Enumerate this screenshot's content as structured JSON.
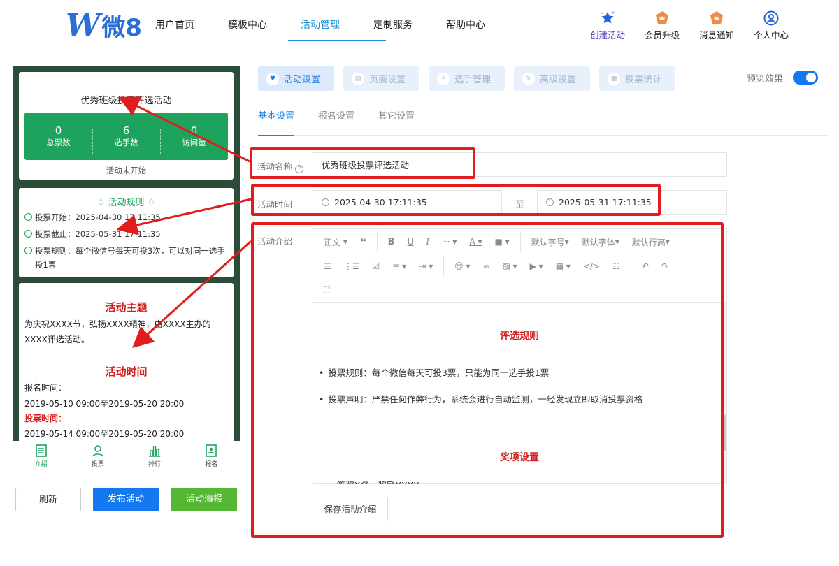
{
  "brand": {
    "logo_text": "微8"
  },
  "nav": {
    "items": [
      "用户首页",
      "模板中心",
      "活动管理",
      "定制服务",
      "帮助中心"
    ],
    "active": 2
  },
  "header_icons": [
    "创建活动",
    "会员升级",
    "消息通知",
    "个人中心"
  ],
  "preview": {
    "activity_title": "优秀班级投票评选活动",
    "stats": [
      {
        "value": "0",
        "label": "总票数"
      },
      {
        "value": "6",
        "label": "选手数"
      },
      {
        "value": "0",
        "label": "访问量"
      }
    ],
    "status": "活动未开始",
    "rules_title": "活动规则",
    "rules": [
      "投票开始：2025-04-30 17:11:35",
      "投票截止：2025-05-31 17:11:35",
      "投票规则：每个微信号每天可投3次，可以对同一选手投1票"
    ],
    "theme_title": "活动主题",
    "theme_text": "为庆祝XXXX节，弘扬XXXX精神，由XXXX主办的XXXX评选活动。",
    "time_title": "活动时间",
    "signup_label": "报名时间：",
    "signup_time": "2019-05-10 09:00至2019-05-20 20:00",
    "vote_label": "投票时间：",
    "vote_time": "2019-05-14 09:00至2019-05-20 20:00",
    "bottom_nav": [
      "介绍",
      "投票",
      "排行",
      "报名"
    ]
  },
  "buttons": {
    "refresh": "刷新",
    "publish": "发布活动",
    "poster": "活动海报"
  },
  "tabs": [
    "活动设置",
    "页面设置",
    "选手管理",
    "高级设置",
    "投票统计"
  ],
  "preview_toggle_label": "预览效果",
  "subtabs": [
    "基本设置",
    "报名设置",
    "其它设置"
  ],
  "form": {
    "name_label": "活动名称",
    "name_value": "优秀班级投票评选活动",
    "time_label": "活动时间",
    "start_time": "2025-04-30 17:11:35",
    "to_label": "至",
    "end_time": "2025-05-31 17:11:35",
    "intro_label": "活动介绍"
  },
  "editor": {
    "toolbar": {
      "paragraph": "正文",
      "font_size": "默认字号",
      "font_family": "默认字体",
      "line_height": "默认行高"
    },
    "content": {
      "section1_title": "评选规则",
      "item1": "投票规则：每个微信每天可投3票，只能为同一选手投1票",
      "item2": "投票声明：严禁任何作弊行为，系统会进行自动监测，一经发现立即取消投票资格",
      "section2_title": "奖项设置",
      "item3": "一等奖X名，奖励XXXX"
    },
    "save_label": "保存活动介绍"
  },
  "colors": {
    "accent": "#1478f0",
    "green": "#1ea35f",
    "annotation_red": "#e01c1c"
  }
}
